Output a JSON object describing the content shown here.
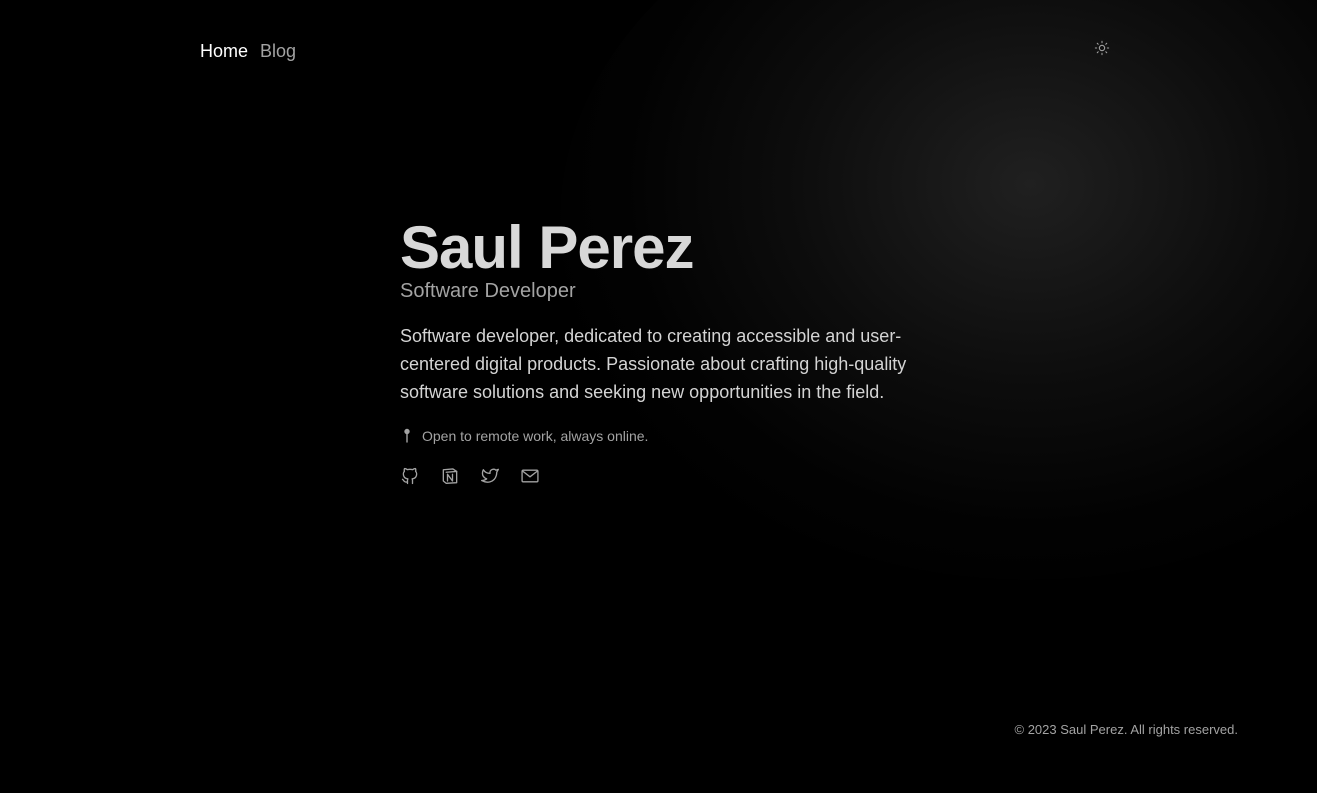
{
  "nav": {
    "home_label": "Home",
    "blog_label": "Blog"
  },
  "theme_toggle": {
    "icon": "sun-icon"
  },
  "hero": {
    "name": "Saul Perez",
    "role": "Software Developer",
    "bio": "Software developer, dedicated to creating accessible and user-centered digital products. Passionate about crafting high-quality software solutions and seeking new opportunities in the field.",
    "location_icon": "pin-icon",
    "location_text": "Open to remote work, always online."
  },
  "socials": [
    {
      "name": "github",
      "icon": "github-icon"
    },
    {
      "name": "notion",
      "icon": "notion-icon"
    },
    {
      "name": "twitter",
      "icon": "twitter-icon"
    },
    {
      "name": "email",
      "icon": "mail-icon"
    }
  ],
  "footer": {
    "copyright": "© 2023 Saul Perez. All rights reserved."
  },
  "colors": {
    "background": "#000000",
    "nav_active": "#ffffff",
    "nav_inactive": "#a3a3a3",
    "heading": "#d8d8d8",
    "muted": "#a3a3a3",
    "body_text": "#d4d4d4"
  }
}
